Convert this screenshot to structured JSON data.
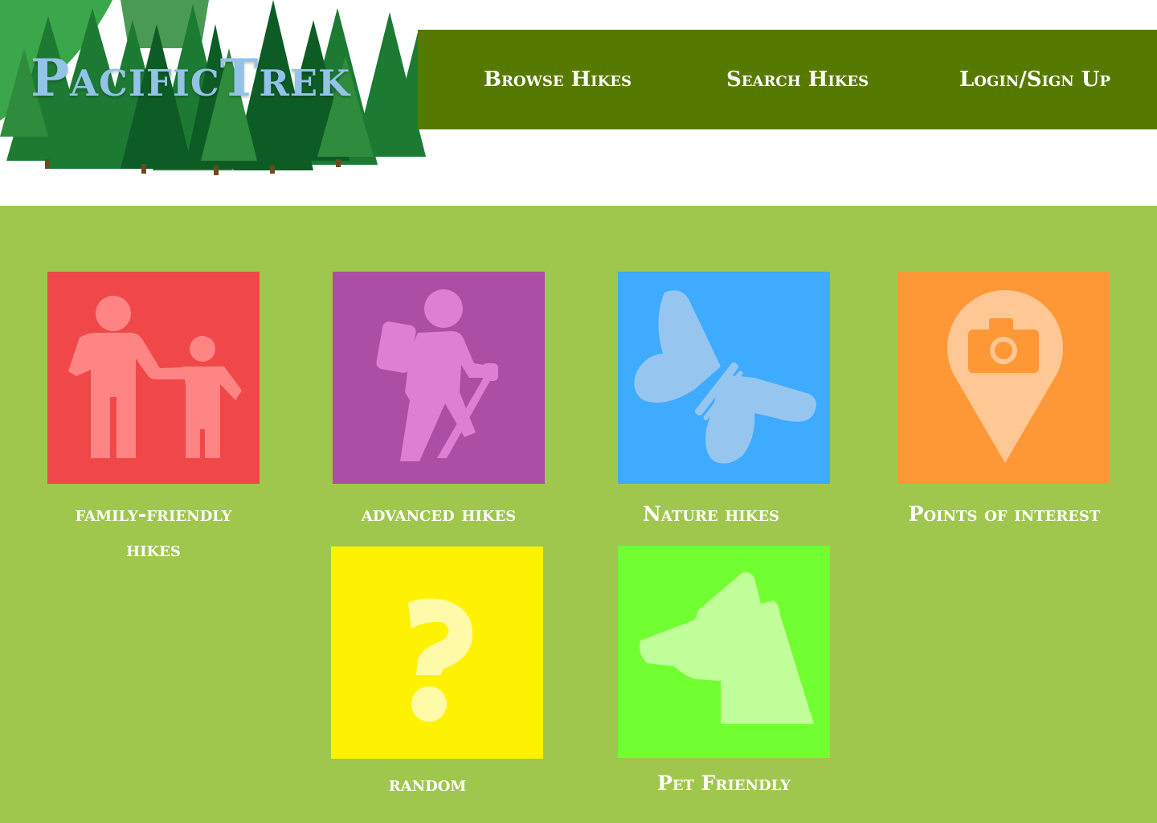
{
  "header": {
    "logo_text": "PacificTrek",
    "nav": [
      {
        "label": "Browse Hikes"
      },
      {
        "label": "Search Hikes"
      },
      {
        "label": "Login/Sign Up"
      }
    ]
  },
  "categories": [
    {
      "label": "family-friendly hikes",
      "icon": "family-icon",
      "color": "#f04848"
    },
    {
      "label": "advanced hikes",
      "icon": "hiker-icon",
      "color": "#aa4fa3"
    },
    {
      "label": "Nature hikes",
      "icon": "butterfly-icon",
      "color": "#3eabfe"
    },
    {
      "label": "Points of interest",
      "icon": "camera-pin-icon",
      "color": "#fe9736"
    },
    {
      "label": "random",
      "icon": "question-mark-icon",
      "color": "#fef200"
    },
    {
      "label": "Pet Friendly",
      "icon": "dog-icon",
      "color": "#72ff31"
    }
  ],
  "colors": {
    "nav_bar": "#567a00",
    "main_background": "#a0c74d",
    "logo_text": "#93c3e6"
  }
}
